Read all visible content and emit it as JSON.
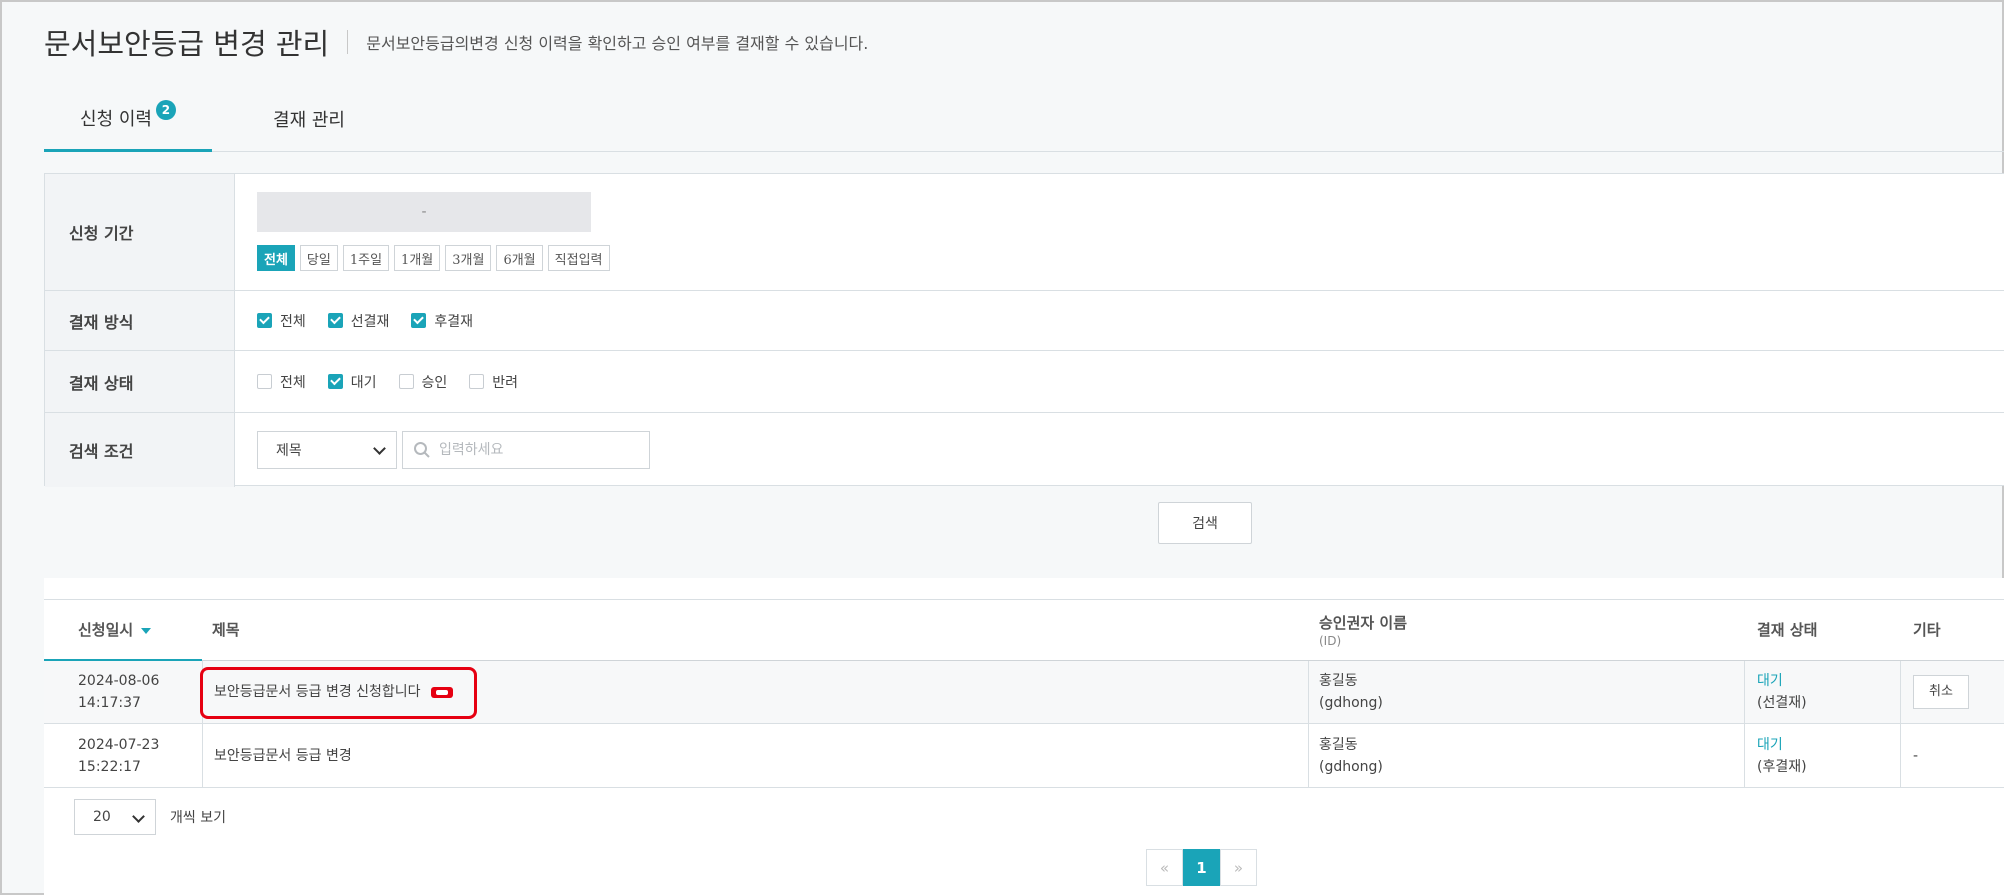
{
  "header": {
    "title": "문서보안등급 변경 관리",
    "description": "문서보안등급의변경 신청 이력을 확인하고 승인 여부를 결재할 수 있습니다."
  },
  "tabs": [
    {
      "label": "신청 이력",
      "badge": "2",
      "active": true
    },
    {
      "label": "결재 관리",
      "active": false
    }
  ],
  "filters": {
    "period_label": "신청 기간",
    "date_range": "-",
    "period_buttons": [
      {
        "label": "전체",
        "active": true
      },
      {
        "label": "당일",
        "active": false
      },
      {
        "label": "1주일",
        "active": false
      },
      {
        "label": "1개월",
        "active": false
      },
      {
        "label": "3개월",
        "active": false
      },
      {
        "label": "6개월",
        "active": false
      },
      {
        "label": "직접입력",
        "active": false
      }
    ],
    "method_label": "결재 방식",
    "method_options": [
      {
        "label": "전체",
        "checked": true
      },
      {
        "label": "선결재",
        "checked": true
      },
      {
        "label": "후결재",
        "checked": true
      }
    ],
    "status_label": "결재 상태",
    "status_options": [
      {
        "label": "전체",
        "checked": false
      },
      {
        "label": "대기",
        "checked": true
      },
      {
        "label": "승인",
        "checked": false
      },
      {
        "label": "반려",
        "checked": false
      }
    ],
    "condition_label": "검색 조건",
    "condition_select": "제목",
    "search_placeholder": "입력하세요"
  },
  "search_button": "검색",
  "table": {
    "columns": {
      "date": "신청일시",
      "title": "제목",
      "approver": "승인권자 이름",
      "approver_sub": "(ID)",
      "status": "결재 상태",
      "etc": "기타"
    },
    "rows": [
      {
        "date": "2024-08-06",
        "time": "14:17:37",
        "title": "보안등급문서 등급 변경 신청합니다",
        "approver": "홍길동",
        "approver_id": "(gdhong)",
        "status": "대기",
        "status_sub": "(선결재)",
        "etc": "취소"
      },
      {
        "date": "2024-07-23",
        "time": "15:22:17",
        "title": "보안등급문서 등급 변경",
        "approver": "홍길동",
        "approver_id": "(gdhong)",
        "status": "대기",
        "status_sub": "(후결재)",
        "etc": "-"
      }
    ]
  },
  "pagination": {
    "page_size": "20",
    "page_size_label": "개씩 보기",
    "prev": "«",
    "current": "1",
    "next": "»"
  },
  "colors": {
    "accent": "#1aa4b8",
    "highlight": "#e60012"
  }
}
